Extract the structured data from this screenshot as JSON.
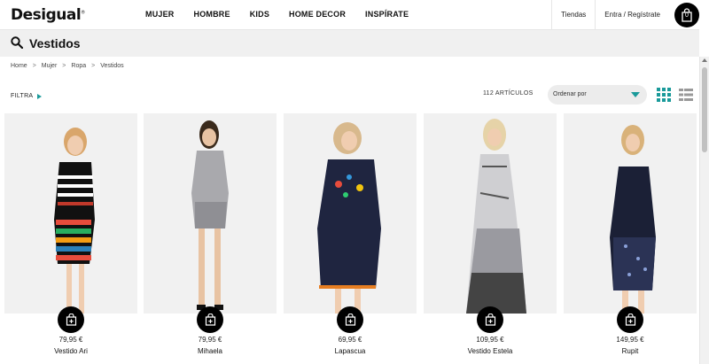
{
  "brand": {
    "logo_text": "Desigual",
    "logo_reg": "®"
  },
  "nav": [
    {
      "label": "MUJER"
    },
    {
      "label": "HOMBRE"
    },
    {
      "label": "KIDS"
    },
    {
      "label": "HOME DECOR"
    },
    {
      "label": "INSPÍRATE"
    }
  ],
  "header_links": {
    "stores": "Tiendas",
    "login": "Entra / Regístrate",
    "bag_count": "0"
  },
  "search": {
    "title": "Vestidos",
    "icon": "search-icon"
  },
  "breadcrumb": [
    "Home",
    "Mujer",
    "Ropa",
    "Vestidos"
  ],
  "toolbar": {
    "filter_label": "FILTRA",
    "count_text": "112 ARTÍCULOS",
    "sort_label": "Ordenar por"
  },
  "colors": {
    "accent": "#1a9a9a",
    "bar": "#f0f0f0",
    "text": "#111111"
  },
  "products": [
    {
      "name": "Vestido Ari",
      "price": "79,95 €"
    },
    {
      "name": "Mihaela",
      "price": "79,95 €"
    },
    {
      "name": "Lapascua",
      "price": "69,95 €"
    },
    {
      "name": "Vestido Estela",
      "price": "109,95 €"
    },
    {
      "name": "Rupit",
      "price": "149,95 €"
    }
  ]
}
